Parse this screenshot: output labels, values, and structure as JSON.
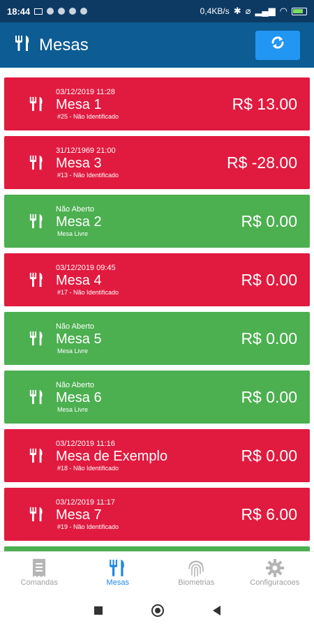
{
  "status_bar": {
    "time": "18:44",
    "network_speed": "0,4KB/s"
  },
  "app_bar": {
    "title": "Mesas",
    "title_icon": "utensils-icon",
    "refresh_icon": "refresh-icon"
  },
  "colors": {
    "occupied": "#e11a3f",
    "free": "#4caf50",
    "app_bar": "#0d5c93",
    "status_bar": "#0d3a63",
    "accent": "#2196f3"
  },
  "tables": [
    {
      "status": "red",
      "date": "03/12/2019 11:28",
      "name": "Mesa 1",
      "sub": "#25 - Não Identificado",
      "value": "R$ 13.00"
    },
    {
      "status": "red",
      "date": "31/12/1969 21:00",
      "name": "Mesa 3",
      "sub": "#13 - Não Identificado",
      "value": "R$ -28.00"
    },
    {
      "status": "green",
      "date": "Não Aberto",
      "name": "Mesa 2",
      "sub": "Mesa Livre",
      "value": "R$ 0.00"
    },
    {
      "status": "red",
      "date": "03/12/2019 09:45",
      "name": "Mesa 4",
      "sub": "#17 - Não Identificado",
      "value": "R$ 0.00"
    },
    {
      "status": "green",
      "date": "Não Aberto",
      "name": "Mesa 5",
      "sub": "Mesa Livre",
      "value": "R$ 0.00"
    },
    {
      "status": "green",
      "date": "Não Aberto",
      "name": "Mesa 6",
      "sub": "Mesa Livre",
      "value": "R$ 0.00"
    },
    {
      "status": "red",
      "date": "03/12/2019 11:16",
      "name": "Mesa de Exemplo",
      "sub": "#18 - Não Identificado",
      "value": "R$ 0.00"
    },
    {
      "status": "red",
      "date": "03/12/2019 11:17",
      "name": "Mesa 7",
      "sub": "#19 - Não Identificado",
      "value": "R$ 6.00"
    },
    {
      "status": "green",
      "date": "",
      "name": "",
      "sub": "",
      "value": ""
    }
  ],
  "bottom_nav": [
    {
      "label": "Comandas",
      "icon": "receipt-icon",
      "active": false
    },
    {
      "label": "Mesas",
      "icon": "utensils-icon",
      "active": true
    },
    {
      "label": "Biometrias",
      "icon": "fingerprint-icon",
      "active": false
    },
    {
      "label": "Configuracoes",
      "icon": "gear-icon",
      "active": false
    }
  ]
}
